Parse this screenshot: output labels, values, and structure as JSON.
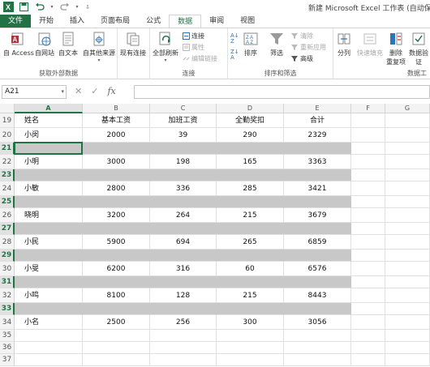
{
  "window": {
    "title": "新建 Microsoft Excel 工作表 (自动保存"
  },
  "tabs": [
    "文件",
    "开始",
    "插入",
    "页面布局",
    "公式",
    "数据",
    "审阅",
    "视图"
  ],
  "ribbon": {
    "get_external": {
      "label": "获取外部数据",
      "buttons": [
        "自 Access",
        "自网站",
        "自文本",
        "自其他来源"
      ]
    },
    "existing_conn": "现有连接",
    "connections": {
      "label": "连接",
      "refresh_all": "全部刷新",
      "small": [
        "连接",
        "属性",
        "编辑链接"
      ]
    },
    "sort_filter": {
      "label": "排序和筛选",
      "sort": "排序",
      "filter": "筛选",
      "small": [
        "清除",
        "重新应用",
        "高级"
      ]
    },
    "data_tools": {
      "label": "数据工",
      "split": "分列",
      "flash_fill": "快速填充",
      "remove_dup": "删除\n重复项",
      "validate": "数据验\n证"
    }
  },
  "formula_bar": {
    "name_box": "A21",
    "value": ""
  },
  "columns": [
    "A",
    "B",
    "C",
    "D",
    "E",
    "F",
    "G"
  ],
  "selected_column": "A",
  "rows": [
    {
      "num": "19",
      "cells": [
        "姓名",
        "基本工资",
        "加班工资",
        "全勤奖扣",
        "合计"
      ],
      "gray": false
    },
    {
      "num": "20",
      "cells": [
        "小闵",
        "2000",
        "39",
        "290",
        "2329"
      ],
      "gray": false
    },
    {
      "num": "21",
      "cells": [
        "",
        "",
        "",
        "",
        ""
      ],
      "gray": true
    },
    {
      "num": "22",
      "cells": [
        "小明",
        "3000",
        "198",
        "165",
        "3363"
      ],
      "gray": false
    },
    {
      "num": "23",
      "cells": [
        "",
        "",
        "",
        "",
        ""
      ],
      "gray": true
    },
    {
      "num": "24",
      "cells": [
        "小敏",
        "2800",
        "336",
        "285",
        "3421"
      ],
      "gray": false
    },
    {
      "num": "25",
      "cells": [
        "",
        "",
        "",
        "",
        ""
      ],
      "gray": true
    },
    {
      "num": "26",
      "cells": [
        "晓明",
        "3200",
        "264",
        "215",
        "3679"
      ],
      "gray": false
    },
    {
      "num": "27",
      "cells": [
        "",
        "",
        "",
        "",
        ""
      ],
      "gray": true
    },
    {
      "num": "28",
      "cells": [
        "小民",
        "5900",
        "694",
        "265",
        "6859"
      ],
      "gray": false
    },
    {
      "num": "29",
      "cells": [
        "",
        "",
        "",
        "",
        ""
      ],
      "gray": true
    },
    {
      "num": "30",
      "cells": [
        "小旻",
        "6200",
        "316",
        "60",
        "6576"
      ],
      "gray": false
    },
    {
      "num": "31",
      "cells": [
        "",
        "",
        "",
        "",
        ""
      ],
      "gray": true
    },
    {
      "num": "32",
      "cells": [
        "小鸣",
        "8100",
        "128",
        "215",
        "8443"
      ],
      "gray": false
    },
    {
      "num": "33",
      "cells": [
        "",
        "",
        "",
        "",
        ""
      ],
      "gray": true
    },
    {
      "num": "34",
      "cells": [
        "小名",
        "2500",
        "256",
        "300",
        "3056"
      ],
      "gray": false
    },
    {
      "num": "35",
      "cells": [
        "",
        "",
        "",
        "",
        ""
      ],
      "gray": false
    },
    {
      "num": "36",
      "cells": [
        "",
        "",
        "",
        "",
        ""
      ],
      "gray": false
    },
    {
      "num": "37",
      "cells": [
        "",
        "",
        "",
        "",
        ""
      ],
      "gray": false
    }
  ],
  "colors": {
    "accent": "#217346",
    "gray_row": "#c8c8c8"
  }
}
